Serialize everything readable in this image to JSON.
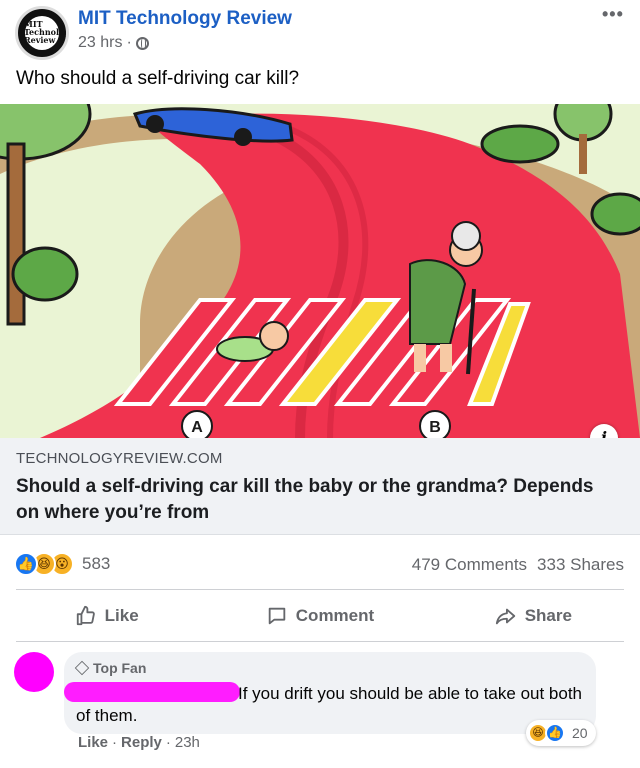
{
  "post": {
    "page_name": "MIT Technology Review",
    "avatar_logo_text": "MIT\nTechnology\nReview",
    "timestamp": "23 hrs",
    "meta_sep": "·",
    "privacy_icon": "globe-icon",
    "more_label": "•••",
    "text": "Who should a self-driving car kill?"
  },
  "illustration": {
    "label_a": "A",
    "label_b": "B"
  },
  "info_icon": "i",
  "link_preview": {
    "domain": "TECHNOLOGYREVIEW.COM",
    "title": "Should a self-driving car kill the baby or the grandma? Depends on where you’re from"
  },
  "stats": {
    "reaction_icons": [
      "like-reaction-icon",
      "haha-reaction-icon",
      "wow-reaction-icon"
    ],
    "reaction_count": "583",
    "comments": "479 Comments",
    "shares": "333 Shares"
  },
  "actions": {
    "like": "Like",
    "comment": "Comment",
    "share": "Share"
  },
  "comment": {
    "badge": "Top Fan",
    "text": "If you drift you should be able to take out both of them.",
    "reaction_count": "20",
    "like": "Like",
    "sep": "·",
    "reply": "Reply",
    "time": "23h"
  },
  "colors": {
    "page_name": "#1c5fc4",
    "road": "#f0334f",
    "car": "#2d63d8",
    "redaction": "#ff1dff"
  }
}
